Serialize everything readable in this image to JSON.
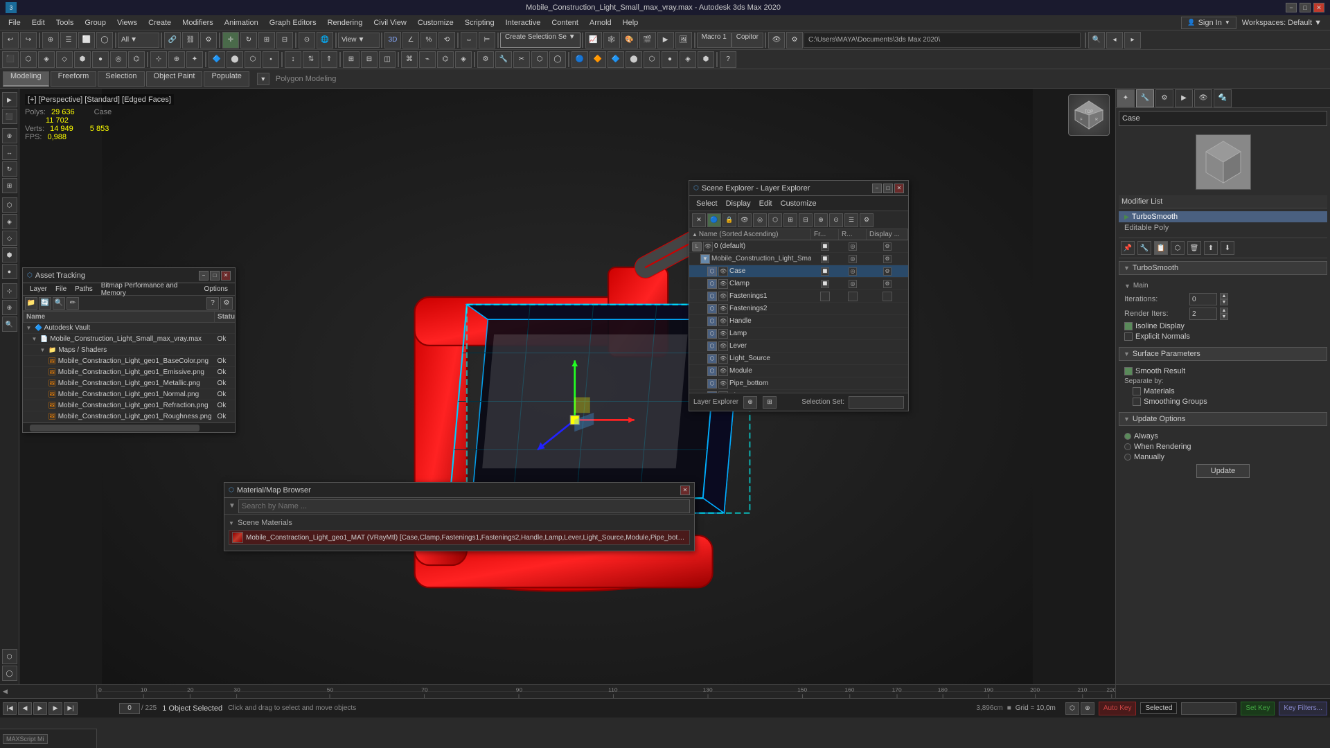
{
  "window": {
    "title": "Mobile_Construction_Light_Small_max_vray.max - Autodesk 3ds Max 2020",
    "min_label": "−",
    "max_label": "□",
    "close_label": "✕"
  },
  "menu": {
    "items": [
      "File",
      "Edit",
      "Tools",
      "Group",
      "Views",
      "Create",
      "Modifiers",
      "Animation",
      "Graph Editors",
      "Rendering",
      "Civil View",
      "Customize",
      "Scripting",
      "Interactive",
      "Content",
      "Arnold",
      "Help"
    ],
    "sign_in": "Sign In",
    "workspaces": "Workspaces: Default"
  },
  "toolbar1": {
    "create_selection": "Create Selection Se",
    "macro1": "Macro 1",
    "copitor": "Copitor",
    "all_dropdown": "All",
    "view_dropdown": "View",
    "path": "C:\\Users\\MAYA\\Documents\\3ds Max 2020\\"
  },
  "tabs": {
    "modeling": "Modeling",
    "freeform": "Freeform",
    "selection": "Selection",
    "object_paint": "Object Paint",
    "populate": "Populate",
    "breadcrumb": "Polygon Modeling"
  },
  "viewport": {
    "label": "[+] [Perspective] [Standard] [Edged Faces]",
    "stats": {
      "polys_label": "Polys:",
      "polys_total": "29 636",
      "polys_case": "Case",
      "polys_case_val": "11 702",
      "verts_label": "Verts:",
      "verts_total": "14 949",
      "verts_case": "5 853",
      "fps_label": "FPS:",
      "fps_val": "0,988"
    }
  },
  "asset_panel": {
    "title": "Asset Tracking",
    "menu": [
      "Layer",
      "File",
      "Paths",
      "Bitmap Performance and Memory",
      "Options"
    ],
    "columns": [
      "Name",
      "Status"
    ],
    "items": [
      {
        "name": "Autodesk Vault",
        "indent": 0,
        "status": "",
        "has_expand": true
      },
      {
        "name": "Mobile_Construction_Light_Small_max_vray.max",
        "indent": 1,
        "status": "Ok",
        "has_expand": true
      },
      {
        "name": "Maps / Shaders",
        "indent": 2,
        "status": "",
        "has_expand": true
      },
      {
        "name": "Mobile_Constraction_Light_geo1_BaseColor.png",
        "indent": 3,
        "status": "Ok",
        "file": true
      },
      {
        "name": "Mobile_Constraction_Light_geo1_Emissive.png",
        "indent": 3,
        "status": "Ok",
        "file": true
      },
      {
        "name": "Mobile_Constraction_Light_geo1_Metallic.png",
        "indent": 3,
        "status": "Ok",
        "file": true
      },
      {
        "name": "Mobile_Constraction_Light_geo1_Normal.png",
        "indent": 3,
        "status": "Ok",
        "file": true
      },
      {
        "name": "Mobile_Constraction_Light_geo1_Refraction.png",
        "indent": 3,
        "status": "Ok",
        "file": true
      },
      {
        "name": "Mobile_Constraction_Light_geo1_Roughness.png",
        "indent": 3,
        "status": "Ok",
        "file": true
      }
    ]
  },
  "scene_panel": {
    "title": "Scene Explorer - Layer Explorer",
    "menu": [
      "Select",
      "Display",
      "Edit",
      "Customize"
    ],
    "columns": {
      "name": "Name (Sorted Ascending)",
      "frozen": "Fr...",
      "render": "R...",
      "display": "Display ..."
    },
    "items": [
      {
        "name": "0 (default)",
        "indent": 0,
        "type": "layer",
        "selected": false
      },
      {
        "name": "Mobile_Construction_Light_Small",
        "indent": 1,
        "type": "object",
        "selected": false
      },
      {
        "name": "Case",
        "indent": 2,
        "type": "mesh",
        "selected": true
      },
      {
        "name": "Clamp",
        "indent": 2,
        "type": "mesh",
        "selected": false
      },
      {
        "name": "Fastenings1",
        "indent": 2,
        "type": "mesh",
        "selected": false
      },
      {
        "name": "Fastenings2",
        "indent": 2,
        "type": "mesh",
        "selected": false
      },
      {
        "name": "Handle",
        "indent": 2,
        "type": "mesh",
        "selected": false
      },
      {
        "name": "Lamp",
        "indent": 2,
        "type": "mesh",
        "selected": false
      },
      {
        "name": "Lever",
        "indent": 2,
        "type": "mesh",
        "selected": false
      },
      {
        "name": "Light_Source",
        "indent": 2,
        "type": "mesh",
        "selected": false
      },
      {
        "name": "Module",
        "indent": 2,
        "type": "mesh",
        "selected": false
      },
      {
        "name": "Pipe_bottom",
        "indent": 2,
        "type": "mesh",
        "selected": false
      },
      {
        "name": "Pipe_top",
        "indent": 2,
        "type": "mesh",
        "selected": false
      }
    ],
    "footer": {
      "layer_explorer": "Layer Explorer",
      "selection_set": "Selection Set:"
    }
  },
  "right_panel": {
    "search_placeholder": "Case",
    "modifier_list_title": "Modifier List",
    "modifiers": [
      {
        "name": "TurboSmooth",
        "active": true
      },
      {
        "name": "Editable Poly",
        "active": false
      }
    ],
    "turbosmooth": {
      "title": "TurboSmooth",
      "main_label": "Main",
      "iterations_label": "Iterations:",
      "iterations_val": "0",
      "render_iters_label": "Render Iters:",
      "render_iters_val": "2",
      "isoline_display": "Isoline Display",
      "explicit_normals": "Explicit Normals"
    },
    "surface_params": {
      "title": "Surface Parameters",
      "smooth_result": "Smooth Result",
      "separate_by": "Separate by:",
      "materials": "Materials",
      "smoothing_groups": "Smoothing Groups"
    },
    "update_options": {
      "title": "Update Options",
      "always": "Always",
      "when_rendering": "When Rendering",
      "manually": "Manually",
      "update_btn": "Update"
    }
  },
  "material_panel": {
    "title": "Material/Map Browser",
    "search_placeholder": "Search by Name ...",
    "section_title": "Scene Materials",
    "material_name": "Mobile_Constraction_Light_geo1_MAT (VRayMtl) [Case,Clamp,Fastenings1,Fastenings2,Handle,Lamp,Lever,Light_Source,Module,Pipe_bottom,Pipe_top]"
  },
  "status_bar": {
    "objects_selected": "1 Object Selected",
    "hint": "Click and drag to select and move objects",
    "grid_label": "Grid = 10,0m",
    "coords": "3,896cm",
    "time": "0 / 225",
    "auto_key": "Auto Key",
    "selected": "Selected",
    "set_key": "Set Key",
    "key_filters": "Key Filters..."
  },
  "timeline": {
    "labels": [
      "0",
      "10",
      "20",
      "30",
      "50",
      "70",
      "90",
      "110",
      "130",
      "150",
      "160",
      "170",
      "180",
      "190",
      "200",
      "210",
      "220"
    ]
  }
}
